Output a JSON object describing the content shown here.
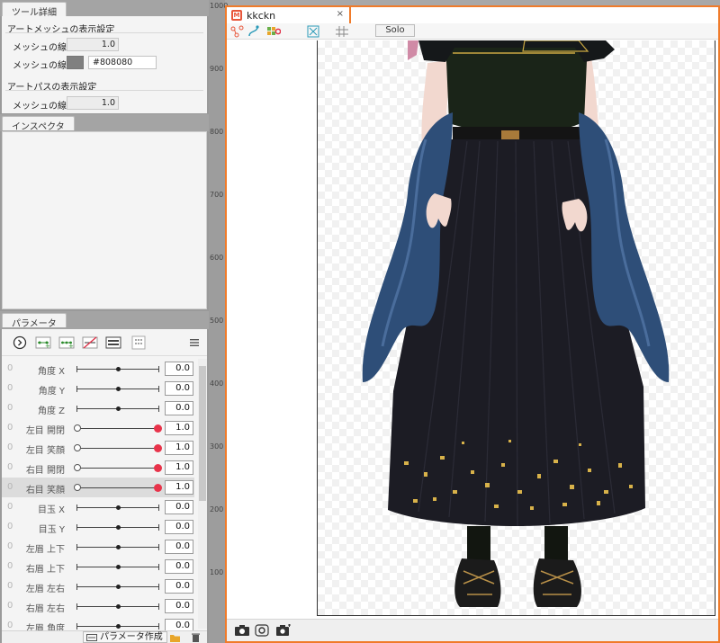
{
  "tool_details": {
    "tab": "ツール詳細",
    "art_mesh_group": "アートメッシュの表示設定",
    "mesh_width_label": "メッシュの線幅",
    "mesh_width_value": "1.0",
    "mesh_color_label": "メッシュの線色",
    "mesh_color_value": "#808080",
    "art_path_group": "アートパスの表示設定",
    "path_width_label": "メッシュの線幅",
    "path_width_value": "1.0"
  },
  "inspector": {
    "tab": "インスペクタ"
  },
  "parameters": {
    "tab": "パラメータ",
    "create_button": "パラメータ作成",
    "rows": [
      {
        "zero": "0",
        "name": "角度 X",
        "value": "0.0",
        "type": "center",
        "selected": false
      },
      {
        "zero": "0",
        "name": "角度 Y",
        "value": "0.0",
        "type": "center",
        "selected": false
      },
      {
        "zero": "0",
        "name": "角度 Z",
        "value": "0.0",
        "type": "center",
        "selected": false
      },
      {
        "zero": "0",
        "name": "左目 開閉",
        "value": "1.0",
        "type": "end",
        "selected": false
      },
      {
        "zero": "0",
        "name": "左目 笑顔",
        "value": "1.0",
        "type": "end",
        "selected": false
      },
      {
        "zero": "0",
        "name": "右目 開閉",
        "value": "1.0",
        "type": "end",
        "selected": false
      },
      {
        "zero": "0",
        "name": "右目 笑顔",
        "value": "1.0",
        "type": "end",
        "selected": true
      },
      {
        "zero": "0",
        "name": "目玉 X",
        "value": "0.0",
        "type": "center",
        "selected": false
      },
      {
        "zero": "0",
        "name": "目玉 Y",
        "value": "0.0",
        "type": "center",
        "selected": false
      },
      {
        "zero": "0",
        "name": "左眉 上下",
        "value": "0.0",
        "type": "center",
        "selected": false
      },
      {
        "zero": "0",
        "name": "右眉 上下",
        "value": "0.0",
        "type": "center",
        "selected": false
      },
      {
        "zero": "0",
        "name": "左眉 左右",
        "value": "0.0",
        "type": "center",
        "selected": false
      },
      {
        "zero": "0",
        "name": "右眉 左右",
        "value": "0.0",
        "type": "center",
        "selected": false
      },
      {
        "zero": "0",
        "name": "左眉 角度",
        "value": "0.0",
        "type": "center",
        "selected": false
      }
    ]
  },
  "viewport": {
    "tab_name": "kkckn",
    "close": "×",
    "solo": "Solo",
    "ruler": [
      "1000",
      "900",
      "800",
      "700",
      "600",
      "500",
      "400",
      "300",
      "200",
      "100"
    ]
  },
  "colors": {
    "accent": "#f07b2a",
    "handle_red": "#e8334a",
    "skirt": "#1c1c24",
    "overskirt": "#2e4e78"
  }
}
